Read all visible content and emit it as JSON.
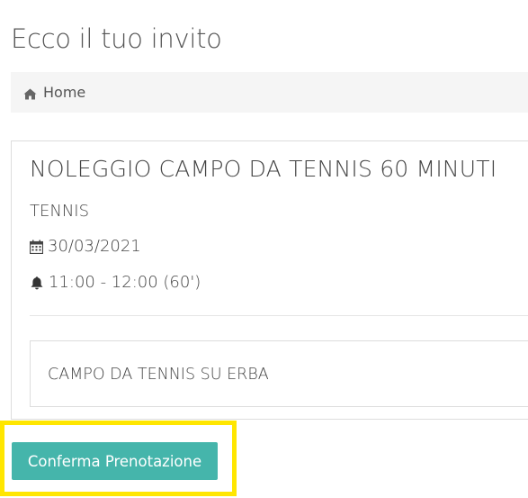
{
  "page": {
    "title": "Ecco il tuo invito"
  },
  "breadcrumb": {
    "icon": "home-icon",
    "label": "Home"
  },
  "event": {
    "title": "NOLEGGIO CAMPO DA TENNIS 60 MINUTI",
    "category": "TENNIS",
    "date_icon": "calendar-icon",
    "date": "30/03/2021",
    "time_icon": "bell-icon",
    "time": "11:00 - 12:00 (60')",
    "location": "CAMPO DA TENNIS SU ERBA"
  },
  "actions": {
    "confirm_label": "Conferma Prenotazione"
  },
  "colors": {
    "accent": "#45b5ab",
    "highlight": "#ffe600",
    "breadcrumb_bg": "#f5f5f5"
  }
}
